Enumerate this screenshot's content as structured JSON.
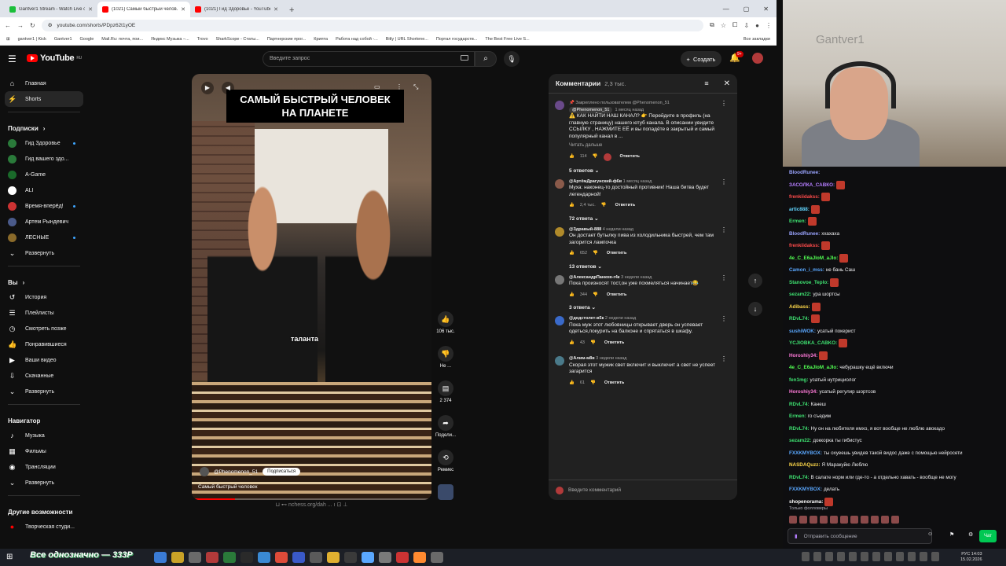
{
  "browser": {
    "tabs": [
      {
        "label": "Gantver1 Stream - Watch Live on...",
        "color": "#1bbf3a",
        "active": false
      },
      {
        "label": "(1021) Самый быстрый челов...",
        "color": "#ff0000",
        "active": true
      },
      {
        "label": "(1021) Гид Здоровье - YouTube",
        "color": "#ff0000",
        "active": false
      }
    ],
    "url": "youtube.com/shorts/PDpz62t1yOE",
    "bookmarks": [
      "gantver1 | Kick",
      "Gantver1",
      "Google",
      "Mail.Ru: почта, пои...",
      "Яндекс Музыка –...",
      "Trovo",
      "SharkScope - Статы...",
      "Партнерские прог...",
      "Крипта",
      "Работа над собой -...",
      "Bitly | URL Shortene...",
      "Портал государств...",
      "The Best Free Live S..."
    ],
    "bookmarks_all": "Все закладки"
  },
  "youtube": {
    "logo_text": "YouTube",
    "logo_region": "RU",
    "search_placeholder": "Введите запрос",
    "create_label": "Создать",
    "notif_count": "9+",
    "sidebar": {
      "main": [
        {
          "label": "Главная",
          "icon": "⌂"
        },
        {
          "label": "Shorts",
          "icon": "⚡",
          "selected": true
        }
      ],
      "subs_title": "Подписки",
      "subs": [
        {
          "label": "Гид Здоровье",
          "color": "#2a7a3a",
          "dot": true
        },
        {
          "label": "Гид вашего здо...",
          "color": "#2a7a3a",
          "dot": true
        },
        {
          "label": "A-Game",
          "color": "#1a6a2a",
          "dot": false
        },
        {
          "label": "ALI",
          "color": "#ffffff",
          "dot": false
        },
        {
          "label": "Время-вперёд!",
          "color": "#cc3333",
          "dot": true
        },
        {
          "label": "Артем Рындевич",
          "color": "#4a5a8a",
          "dot": false
        },
        {
          "label": "ЛЕСНЫЕ",
          "color": "#8a6a2a",
          "dot": true
        }
      ],
      "subs_expand": "Развернуть",
      "you_title": "Вы",
      "you": [
        {
          "label": "История",
          "icon": "↺"
        },
        {
          "label": "Плейлисты",
          "icon": "☰"
        },
        {
          "label": "Смотреть позже",
          "icon": "◷"
        },
        {
          "label": "Понравившиеся",
          "icon": "👍"
        },
        {
          "label": "Ваши видео",
          "icon": "▶"
        },
        {
          "label": "Скачанные",
          "icon": "⇩"
        }
      ],
      "you_expand": "Развернуть",
      "nav_title": "Навигатор",
      "nav": [
        {
          "label": "Музыка",
          "icon": "♪"
        },
        {
          "label": "Фильмы",
          "icon": "▦"
        },
        {
          "label": "Трансляции",
          "icon": "◉"
        }
      ],
      "nav_expand": "Развернуть",
      "more_title": "Другие возможности",
      "more": [
        {
          "label": "Творческая студи...",
          "icon": "●"
        }
      ]
    },
    "video": {
      "title_line1": "САМЫЙ БЫСТРЫЙ ЧЕЛОВЕК",
      "title_line2": "НА ПЛАНЕТЕ",
      "caption": "таланта",
      "channel": "@Phenomenon_51",
      "subscribe": "Подписаться",
      "description": "Самый быстрый человек",
      "below_text": "⊔    ⊷ nchess.org/dah  ...    ı    ⊡    ⊥",
      "progress": 0.18
    },
    "actions": [
      {
        "icon": "👍",
        "label": "106 тыс."
      },
      {
        "icon": "👎",
        "label": "Не ..."
      },
      {
        "icon": "▤",
        "label": "2 374"
      },
      {
        "icon": "➦",
        "label": "Подели..."
      },
      {
        "icon": "⟲",
        "label": "Ремикс"
      }
    ],
    "comments": {
      "title": "Комментарии",
      "count": "2,3 тыс.",
      "input_placeholder": "Введите комментарий",
      "items": [
        {
          "pinned": "Закреплено пользователем @Phenomenon_51",
          "author": "@Phenomenon_51",
          "time": "1 месяц назад",
          "text": "⚠️ КАК НАЙТИ НАШ КАНАЛ? 👉 Перейдите в профиль (на главную страницу) нашего ютуб канала. В описании увидите ССЫЛКУ , НАЖМИТЕ ЕЁ и вы попадёте в закрытый и самый популярный канал в ...",
          "read_more": "Читать дальше",
          "likes": "114",
          "reply": "Ответить",
          "replies": "5 ответов",
          "avatar_color": "#6a4a8a",
          "heart": true
        },
        {
          "author": "@АртёмДрагунский-ф6в",
          "time": "1 месяц назад",
          "text": "Муха: наконец-то достойный противник! Наша битва будет легендарной!",
          "likes": "2,4 тыс.",
          "reply": "Ответить",
          "replies": "72 ответа",
          "avatar_color": "#8a5a4a"
        },
        {
          "author": "@Здравый-888",
          "time": "4 недели назад",
          "text": "Он достает бутылку пива из холодильника быстрей, чем там загорится лампочка",
          "likes": "652",
          "reply": "Ответить",
          "replies": "13 ответов",
          "avatar_color": "#b08a2a"
        },
        {
          "author": "@АлександрПанков-г4к",
          "time": "3 недели назад",
          "text": "Пока произносят тост,он уже похмеляться начинает😂",
          "likes": "344",
          "reply": "Ответить",
          "replies": "3 ответа",
          "avatar_color": "#777777"
        },
        {
          "author": "@дедстолет-в5к",
          "time": "2 недели назад",
          "text": "Пока муж этот любовницы открывает дверь он успевает одеться,покурить на балконе и спрятаться в шкафу.",
          "likes": "43",
          "reply": "Ответить",
          "avatar_color": "#3a6aca"
        },
        {
          "author": "@Алим-м8в",
          "time": "3 недели назад",
          "text": "Скорая этот мужик свет включит и выключит а свет не успеет загарится",
          "likes": "61",
          "reply": "Ответить",
          "avatar_color": "#4a7a8a"
        }
      ]
    }
  },
  "stream": {
    "watermark": "Gantver1",
    "chat": [
      {
        "user": "BloodRunee:",
        "color": "#9aa4ff",
        "text": "",
        "emote": false
      },
      {
        "user": "ЗАСОЛКА_САВКО:",
        "color": "#b57dff",
        "text": "",
        "emote": true
      },
      {
        "user": "frenkiidakss:",
        "color": "#ff4b4b",
        "text": "",
        "emote": true
      },
      {
        "user": "artic888:",
        "color": "#61d6ff",
        "text": "",
        "emote": true
      },
      {
        "user": "Ermen:",
        "color": "#3ee070",
        "text": "",
        "emote": true
      },
      {
        "user": "BloodRunee:",
        "color": "#9aa4ff",
        "text": "ххахаха",
        "emote": false
      },
      {
        "user": "frenkiidakss:",
        "color": "#ff4b4b",
        "text": "",
        "emote": true
      },
      {
        "user": "4e_C_E6aJIoM_aJIo:",
        "color": "#52ff52",
        "text": "",
        "emote": true
      },
      {
        "user": "Camon_i_mss:",
        "color": "#5aa8ff",
        "text": "не бань Саш",
        "emote": false
      },
      {
        "user": "Stanovoe_Teplo:",
        "color": "#3ee070",
        "text": "",
        "emote": true
      },
      {
        "user": "sezam22:",
        "color": "#3ee070",
        "text": "ура шортсы",
        "emote": false
      },
      {
        "user": "Adibass:",
        "color": "#ffd94a",
        "text": "",
        "emote": true
      },
      {
        "user": "RDvL74:",
        "color": "#3ee070",
        "text": "",
        "emote": true
      },
      {
        "user": "sushiWOK:",
        "color": "#5aa8ff",
        "text": "усатый покерист",
        "emote": false
      },
      {
        "user": "YCJIOBKA_CABKO:",
        "color": "#3ee070",
        "text": "",
        "emote": true
      },
      {
        "user": "Horoshiy34:",
        "color": "#ff7ad9",
        "text": "",
        "emote": true
      },
      {
        "user": "4e_C_E6aJIoM_aJIo:",
        "color": "#52ff52",
        "text": "чебурашку ещё включи",
        "emote": false
      },
      {
        "user": "fen1mg:",
        "color": "#3ee070",
        "text": "усатый нутрициолог",
        "emote": false
      },
      {
        "user": "Horoshiy34:",
        "color": "#ff7ad9",
        "text": "усатый регулир шортсов",
        "emote": false
      },
      {
        "user": "RDvL74:",
        "color": "#3ee070",
        "text": "Канеш",
        "emote": false
      },
      {
        "user": "Ermen:",
        "color": "#3ee070",
        "text": "го съедим",
        "emote": false
      },
      {
        "user": "RDvL74:",
        "color": "#3ee070",
        "text": "Ну он на любителя имхо, я вот вообще не люблю авокадо",
        "emote": false
      },
      {
        "user": "sezam22:",
        "color": "#3ee070",
        "text": "доккорка ты гибистус",
        "emote": false
      },
      {
        "user": "FXXKMYBOX:",
        "color": "#5aa8ff",
        "text": "ты охуеешь увидев такой видос даже с помощью нейросети",
        "emote": false
      },
      {
        "user": "NASDAQuzz:",
        "color": "#ffd94a",
        "text": "Я Маракуйю Люблю",
        "emote": false
      },
      {
        "user": "RDvL74:",
        "color": "#3ee070",
        "text": "В салате норм или где-то - а отдельно хавать - вообще не могу",
        "emote": false
      },
      {
        "user": "FXXKMYBOX:",
        "color": "#5aa8ff",
        "text": "делать",
        "emote": false
      },
      {
        "user": "shopenorama:",
        "color": "#ffffff",
        "text": "",
        "emote": true
      }
    ],
    "followers_only": "Только фолловеры",
    "chat_placeholder": "Отправить сообщение",
    "chat_button": "Чат"
  },
  "taskbar": {
    "ticker": "Все однозначно — 333P",
    "time": "14:03",
    "date": "15.02.2026",
    "lang": "РУС"
  }
}
